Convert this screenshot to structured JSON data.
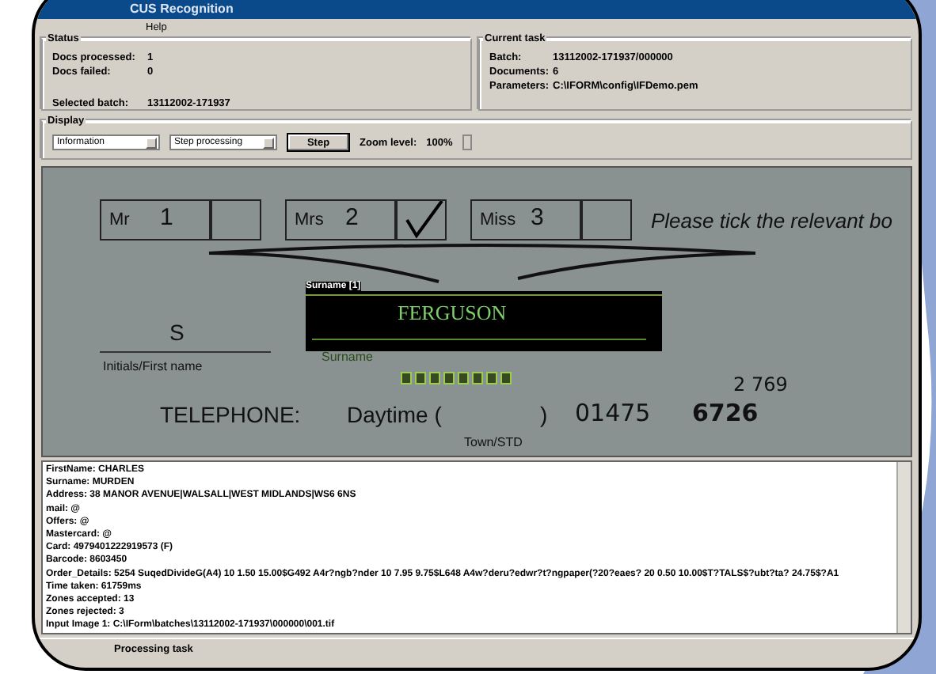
{
  "window": {
    "title": "CUS Recognition"
  },
  "menu": [
    {
      "label": "Help"
    }
  ],
  "status": {
    "title": "Status",
    "fields": [
      {
        "label": "Docs processed:",
        "value": "1"
      },
      {
        "label": "Docs failed:",
        "value": "0"
      }
    ],
    "selected_batch": {
      "label": "Selected batch:",
      "value": "13112002-171937"
    }
  },
  "current_task": {
    "title": "Current task",
    "fields": [
      {
        "label": "Batch:",
        "value": "13112002-171937/000000"
      },
      {
        "label": "Documents:",
        "value": "6"
      },
      {
        "label": "Parameters:",
        "value": "C:\\IFORM\\config\\IFDemo.pem"
      }
    ]
  },
  "display": {
    "title": "Display",
    "view_select": "Information",
    "mode_select": "Step processing",
    "step_button": "Step",
    "zoom_label": "Zoom level:",
    "zoom_value": "100%"
  },
  "document": {
    "title_boxes": [
      {
        "title": "Mr",
        "number": "1",
        "ticked": false
      },
      {
        "title": "Mrs",
        "number": "2",
        "ticked": true
      },
      {
        "title": "Miss",
        "number": "3",
        "ticked": false
      }
    ],
    "instruction": "Please tick the relevant bo",
    "initial": "S",
    "initial_label": "Initials/First name",
    "zone": {
      "caption": "Surname [1]",
      "value": "FERGUSON",
      "field_label": "Surname"
    },
    "telephone": {
      "label": "TELEPHONE:",
      "daytime": "Daytime (",
      "close": ")",
      "town_label": "Town/STD",
      "number_1": "01475",
      "number_2": "6726",
      "correction": "2 769"
    }
  },
  "log": [
    "FirstName: CHARLES",
    "Surname: MURDEN",
    "Address: 38 MANOR AVENUE|WALSALL|WEST MIDLANDS|WS6 6NS",
    "mail: @",
    "Offers: @",
    "Mastercard: @",
    "Card: 4979401222919573 (F)",
    "Barcode: 8603450",
    "Order_Details: 5254 SuqedDivideG(A4) 10 1.50 15.00$G492 A4r?ngb?nder 10 7.95 9.75$L648 A4w?deru?edwr?t?ngpaper(?20?eaes? 20 0.50 10.00$T?TALS$?ubt?ta? 24.75$?A1",
    "Time taken: 61759ms",
    "Zones accepted: 13",
    "Zones rejected: 3",
    "Input Image 1:  C:\\IForm\\batches\\13112002-171937\\000000\\001.tif"
  ],
  "status_bar": "Processing task"
}
